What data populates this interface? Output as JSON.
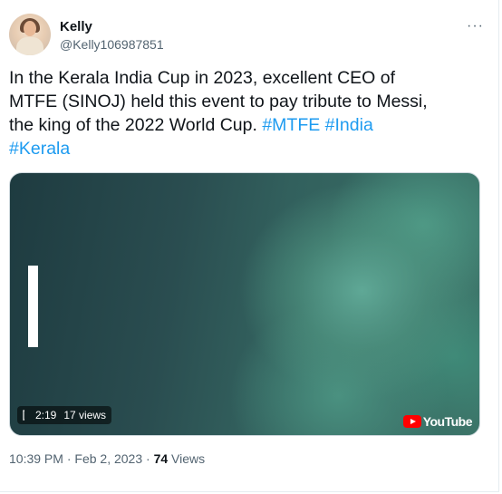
{
  "author": {
    "name": "Kelly",
    "handle": "@Kelly106987851"
  },
  "more_label": "···",
  "tweet": {
    "text_lines": [
      "In the Kerala India Cup in 2023, excellent CEO of",
      "MTFE (SINOJ) held this event to pay tribute to Messi,",
      "the king of the 2022 World Cup."
    ],
    "hashtags": [
      "#MTFE",
      "#India",
      "#Kerala"
    ]
  },
  "media": {
    "duration": "2:19",
    "views": "17 views",
    "source_label": "YouTube"
  },
  "meta": {
    "time": "10:39 PM",
    "separator": "·",
    "date": "Feb 2, 2023",
    "views_count": "74",
    "views_label": "Views"
  }
}
